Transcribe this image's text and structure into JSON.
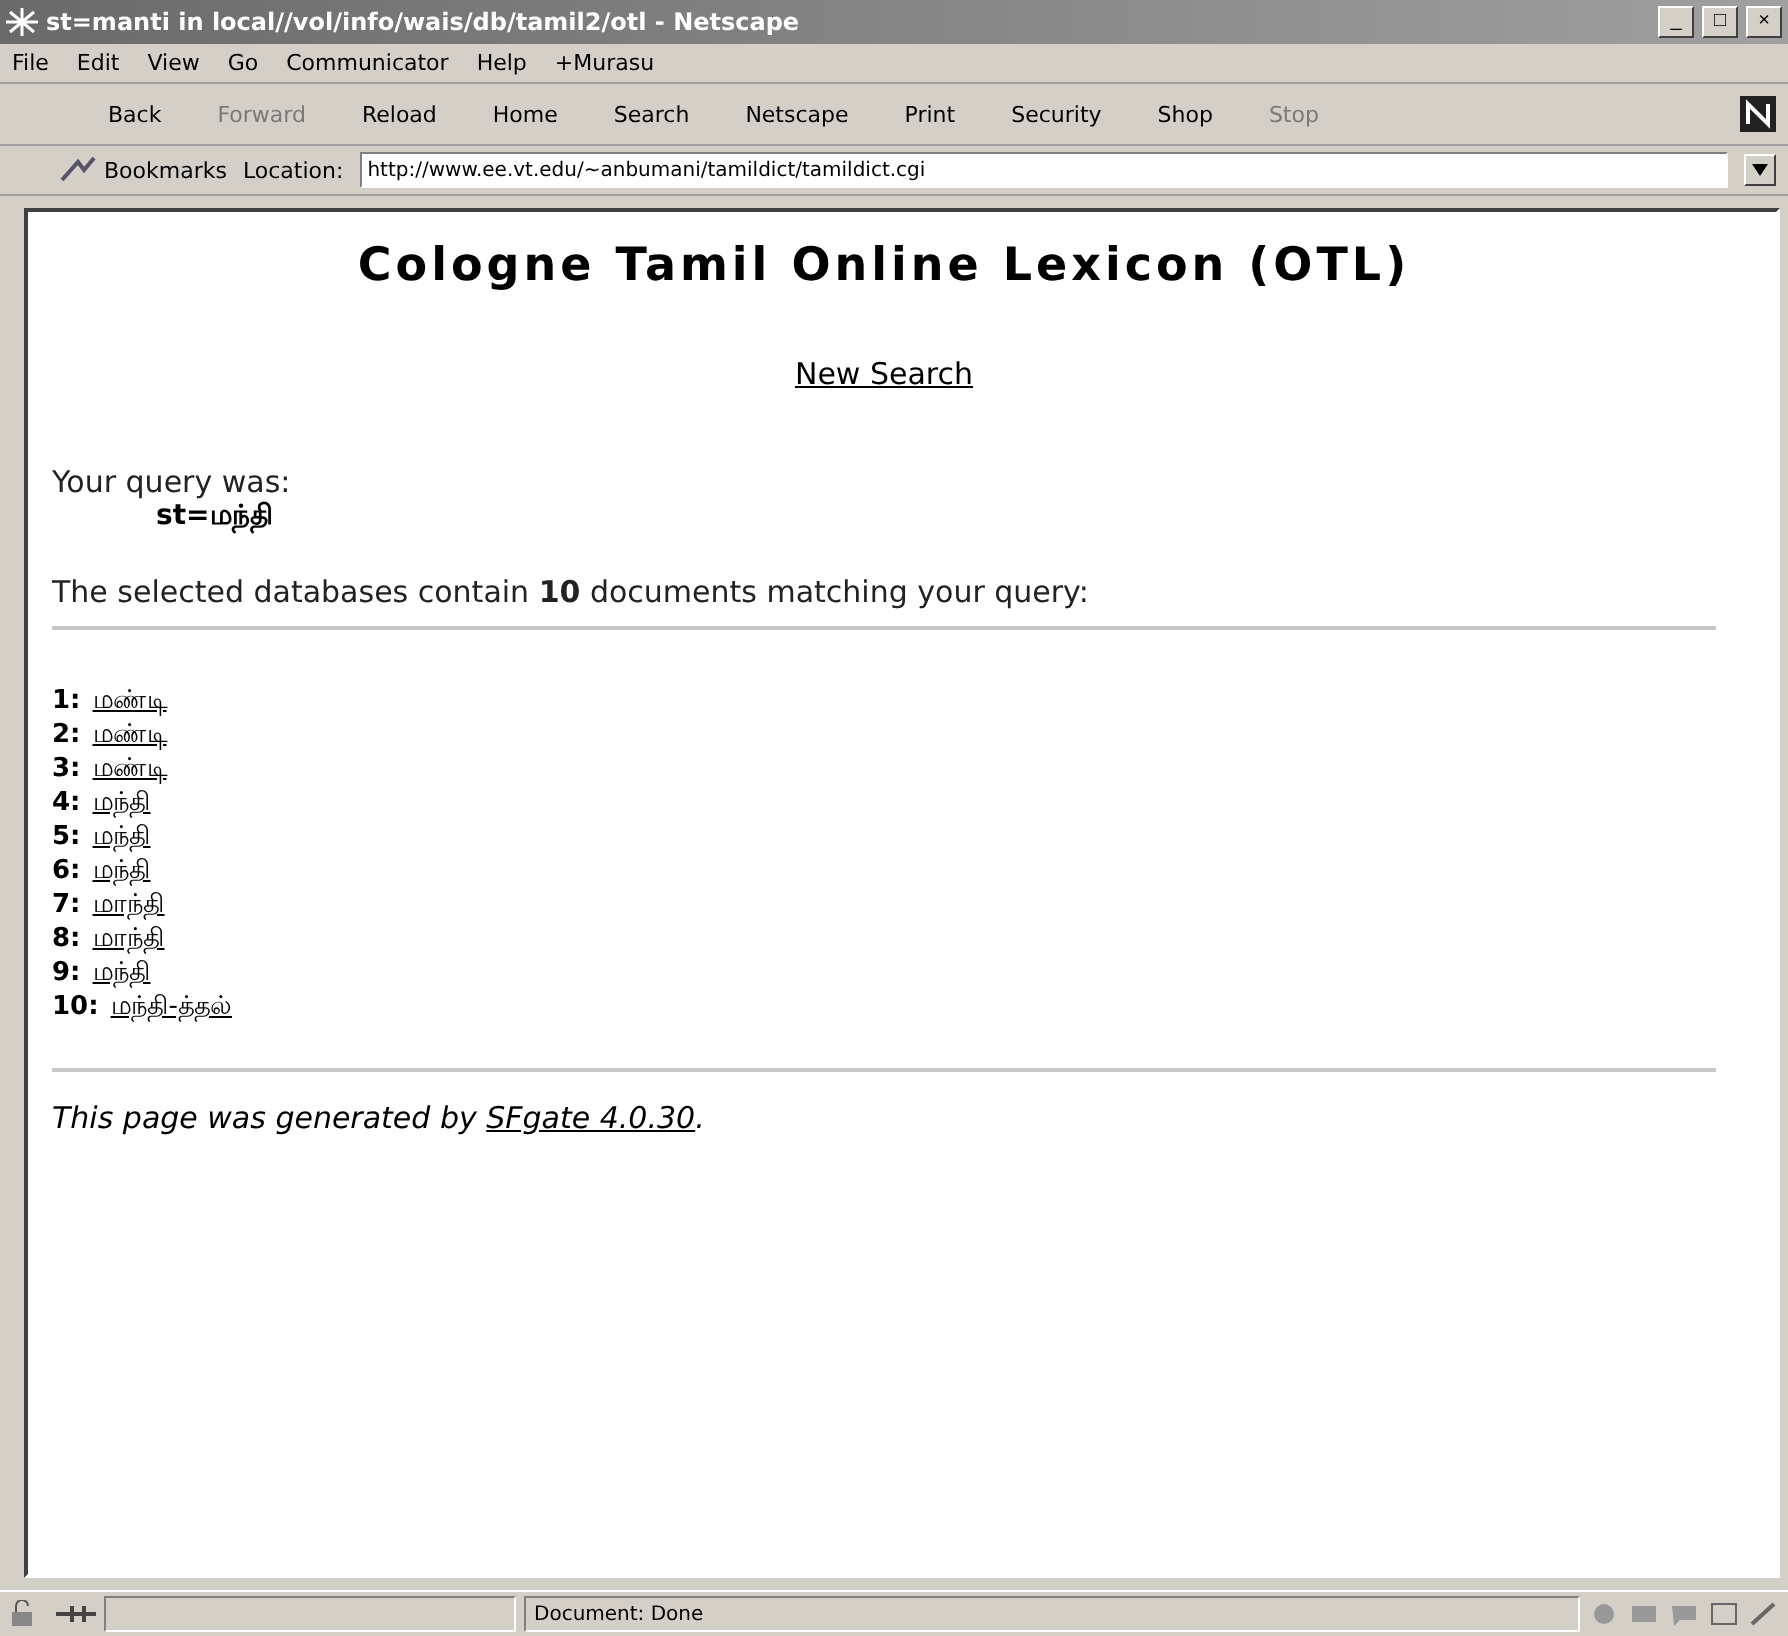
{
  "window": {
    "title": "st=manti in local//vol/info/wais/db/tamil2/otl - Netscape",
    "controls": [
      "_",
      "□",
      "×"
    ]
  },
  "menu": [
    "File",
    "Edit",
    "View",
    "Go",
    "Communicator",
    "Help",
    "+Murasu"
  ],
  "toolbar": [
    {
      "label": "Back",
      "disabled": false
    },
    {
      "label": "Forward",
      "disabled": true
    },
    {
      "label": "Reload",
      "disabled": false
    },
    {
      "label": "Home",
      "disabled": false
    },
    {
      "label": "Search",
      "disabled": false
    },
    {
      "label": "Netscape",
      "disabled": false
    },
    {
      "label": "Print",
      "disabled": false
    },
    {
      "label": "Security",
      "disabled": false
    },
    {
      "label": "Shop",
      "disabled": false
    },
    {
      "label": "Stop",
      "disabled": true
    }
  ],
  "location_bar": {
    "bookmarks": "Bookmarks",
    "location_label": "Location:",
    "url": "http://www.ee.vt.edu/~anbumani/tamildict/tamildict.cgi"
  },
  "page": {
    "heading": "Cologne Tamil Online Lexicon (OTL)",
    "new_search": "New Search",
    "query_label": "Your query was:",
    "query": "st=மந்தி",
    "summary": "The selected databases contain **10** documents matching your query:",
    "results": [
      {
        "number": "1:",
        "word": "மண்டி"
      },
      {
        "number": "2:",
        "word": "மண்டி"
      },
      {
        "number": "3:",
        "word": "மண்டி"
      },
      {
        "number": "4:",
        "word": "மந்தி"
      },
      {
        "number": "5:",
        "word": "மந்தி"
      },
      {
        "number": "6:",
        "word": "மந்தி"
      },
      {
        "number": "7:",
        "word": "மாந்தி"
      },
      {
        "number": "8:",
        "word": "மாந்தி"
      },
      {
        "number": "9:",
        "word": "மந்தி"
      },
      {
        "number": "10:",
        "word": "மந்தி-த்தல்"
      }
    ],
    "footer_text": "This page was generated by",
    "footer_link": "SFgate 4.0.30",
    "footer_end": "."
  },
  "status_bar": {
    "text": "Document: Done"
  }
}
